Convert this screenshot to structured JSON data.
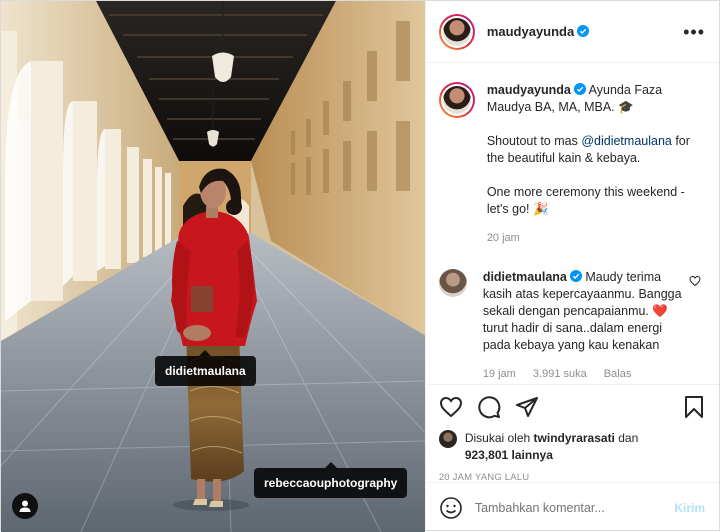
{
  "colors": {
    "link": "#00376b",
    "verified": "#0095f6",
    "muted": "#8e8e8e",
    "post_disabled": "#b2dffc",
    "heart": "#ed4956"
  },
  "photo": {
    "tags": [
      "didietmaulana",
      "rebeccaouphotography"
    ],
    "user_tag_icon": "person-icon"
  },
  "header": {
    "username": "maudyayunda",
    "verified_icon": "verified-badge-icon",
    "more_icon": "more-options-icon"
  },
  "caption": {
    "username": "maudyayunda",
    "line1": "Ayunda Faza Maudya BA, MA, MBA. 🎓",
    "line2_pre": "Shoutout to mas ",
    "line2_mention": "@didietmaulana",
    "line2_post": " for the beautiful kain & kebaya.",
    "line3": "One more ceremony this weekend - let's go! 🎉",
    "time": "20 jam"
  },
  "comment": {
    "username": "didietmaulana",
    "text_pre": "Maudy terima kasih atas kepercayaanmu. Bangga sekali dengan pencapaianmu. ",
    "heart_emoji": "❤️",
    "text_post": " turut hadir di sana..dalam energi pada kebaya yang kau kenakan",
    "time": "19 jam",
    "likes": "3.991 suka",
    "reply": "Balas"
  },
  "actions": {
    "icons": [
      "heart-icon",
      "comment-icon",
      "share-icon",
      "bookmark-icon"
    ],
    "liked_by_prefix": "Disukai oleh",
    "liked_by_user": "twindyrarasati",
    "liked_by_and": "dan",
    "others_count": "923,801",
    "others_suffix": "lainnya",
    "date": "20 JAM YANG LALU"
  },
  "add_comment": {
    "placeholder": "Tambahkan komentar...",
    "post_label": "Kirim"
  }
}
